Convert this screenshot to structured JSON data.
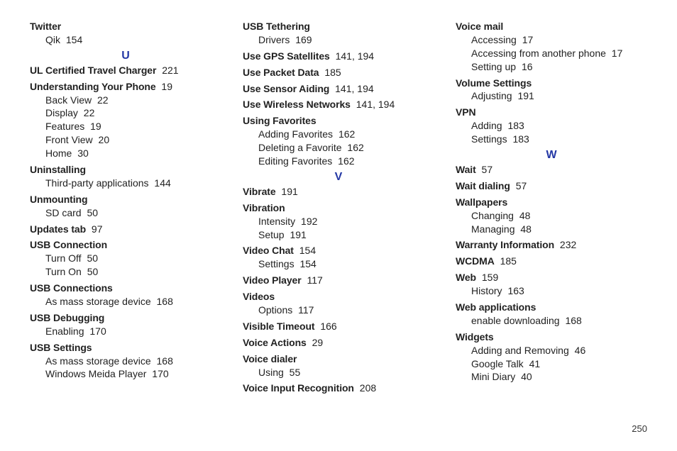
{
  "page_number": "250",
  "columns": [
    {
      "items": [
        {
          "type": "entry",
          "term": "Twitter",
          "subs": [
            {
              "label": "Qik",
              "page": "154"
            }
          ]
        },
        {
          "type": "letter",
          "text": "U"
        },
        {
          "type": "entry",
          "term": "UL Certified Travel Charger",
          "page": "221"
        },
        {
          "type": "entry",
          "term": "Understanding Your Phone",
          "page": "19",
          "subs": [
            {
              "label": "Back View",
              "page": "22"
            },
            {
              "label": "Display",
              "page": "22"
            },
            {
              "label": "Features",
              "page": "19"
            },
            {
              "label": "Front View",
              "page": "20"
            },
            {
              "label": "Home",
              "page": "30"
            }
          ]
        },
        {
          "type": "entry",
          "term": "Uninstalling",
          "subs": [
            {
              "label": "Third-party applications",
              "page": "144"
            }
          ]
        },
        {
          "type": "entry",
          "term": "Unmounting",
          "subs": [
            {
              "label": "SD card",
              "page": "50"
            }
          ]
        },
        {
          "type": "entry",
          "term": "Updates tab",
          "page": "97"
        },
        {
          "type": "entry",
          "term": "USB Connection",
          "subs": [
            {
              "label": "Turn Off",
              "page": "50"
            },
            {
              "label": "Turn On",
              "page": "50"
            }
          ]
        },
        {
          "type": "entry",
          "term": "USB Connections",
          "subs": [
            {
              "label": "As mass storage device",
              "page": "168"
            }
          ]
        },
        {
          "type": "entry",
          "term": "USB Debugging",
          "subs": [
            {
              "label": "Enabling",
              "page": "170"
            }
          ]
        },
        {
          "type": "entry",
          "term": "USB Settings",
          "subs": [
            {
              "label": "As mass storage device",
              "page": "168"
            },
            {
              "label": "Windows Meida Player",
              "page": "170"
            }
          ]
        }
      ]
    },
    {
      "items": [
        {
          "type": "entry",
          "term": "USB Tethering",
          "subs": [
            {
              "label": "Drivers",
              "page": "169"
            }
          ]
        },
        {
          "type": "entry",
          "term": "Use GPS Satellites",
          "page": "141, 194"
        },
        {
          "type": "entry",
          "term": "Use Packet Data",
          "page": "185"
        },
        {
          "type": "entry",
          "term": "Use Sensor Aiding",
          "page": "141, 194"
        },
        {
          "type": "entry",
          "term": "Use Wireless Networks",
          "page": "141, 194"
        },
        {
          "type": "entry",
          "term": "Using Favorites",
          "subs": [
            {
              "label": "Adding Favorites",
              "page": "162"
            },
            {
              "label": "Deleting a Favorite",
              "page": "162"
            },
            {
              "label": "Editing Favorites",
              "page": "162"
            }
          ]
        },
        {
          "type": "letter",
          "text": "V"
        },
        {
          "type": "entry",
          "term": "Vibrate",
          "page": "191"
        },
        {
          "type": "entry",
          "term": "Vibration",
          "subs": [
            {
              "label": "Intensity",
              "page": "192"
            },
            {
              "label": "Setup",
              "page": "191"
            }
          ]
        },
        {
          "type": "entry",
          "term": "Video Chat",
          "page": "154",
          "subs": [
            {
              "label": "Settings",
              "page": "154"
            }
          ]
        },
        {
          "type": "entry",
          "term": "Video Player",
          "page": "117"
        },
        {
          "type": "entry",
          "term": "Videos",
          "subs": [
            {
              "label": "Options",
              "page": "117"
            }
          ]
        },
        {
          "type": "entry",
          "term": "Visible Timeout",
          "page": "166"
        },
        {
          "type": "entry",
          "term": "Voice Actions",
          "page": "29"
        },
        {
          "type": "entry",
          "term": "Voice dialer",
          "subs": [
            {
              "label": "Using",
              "page": "55"
            }
          ]
        },
        {
          "type": "entry",
          "term": "Voice Input Recognition",
          "page": "208"
        }
      ]
    },
    {
      "items": [
        {
          "type": "entry",
          "term": "Voice mail",
          "subs": [
            {
              "label": "Accessing",
              "page": "17"
            },
            {
              "label": "Accessing from another phone",
              "page": "17"
            },
            {
              "label": "Setting up",
              "page": "16"
            }
          ]
        },
        {
          "type": "entry",
          "term": "Volume Settings",
          "subs": [
            {
              "label": "Adjusting",
              "page": "191"
            }
          ]
        },
        {
          "type": "entry",
          "term": "VPN",
          "subs": [
            {
              "label": "Adding",
              "page": "183"
            },
            {
              "label": "Settings",
              "page": "183"
            }
          ]
        },
        {
          "type": "letter",
          "text": "W"
        },
        {
          "type": "entry",
          "term": "Wait",
          "page": "57"
        },
        {
          "type": "entry",
          "term": "Wait dialing",
          "page": "57"
        },
        {
          "type": "entry",
          "term": "Wallpapers",
          "subs": [
            {
              "label": "Changing",
              "page": "48"
            },
            {
              "label": "Managing",
              "page": "48"
            }
          ]
        },
        {
          "type": "entry",
          "term": "Warranty Information",
          "page": "232"
        },
        {
          "type": "entry",
          "term": "WCDMA",
          "page": "185"
        },
        {
          "type": "entry",
          "term": "Web",
          "page": "159",
          "subs": [
            {
              "label": "History",
              "page": "163"
            }
          ]
        },
        {
          "type": "entry",
          "term": "Web applications",
          "subs": [
            {
              "label": "enable downloading",
              "page": "168"
            }
          ]
        },
        {
          "type": "entry",
          "term": "Widgets",
          "subs": [
            {
              "label": "Adding and Removing",
              "page": "46"
            },
            {
              "label": "Google Talk",
              "page": "41"
            },
            {
              "label": "Mini Diary",
              "page": "40"
            }
          ]
        }
      ]
    }
  ]
}
